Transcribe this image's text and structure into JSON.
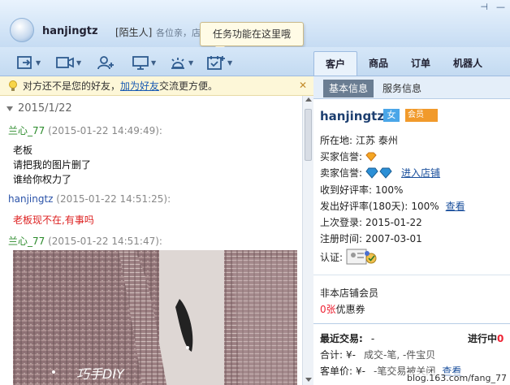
{
  "header": {
    "username": "hanjingtz",
    "tag": "[陌生人]",
    "greeting": "各位亲，店主不"
  },
  "tooltip": {
    "text": "任务功能在这里哦"
  },
  "right_tabs": [
    "客户",
    "商品",
    "订单",
    "机器人"
  ],
  "notice": {
    "before": "对方还不是您的好友，",
    "link": "加为好友",
    "after": "交流更方便。",
    "close": "✕"
  },
  "chat": {
    "date": "2015/1/22",
    "messages": [
      {
        "sender": "兰心_77",
        "time": "(2015-01-22 14:49:49):",
        "lines": [
          "老板",
          "请把我的图片删了",
          "谁给你权力了"
        ]
      },
      {
        "sender": "hanjingtz",
        "time": "(2015-01-22 14:51:25):",
        "lines": [
          "老板现不在,有事吗"
        ]
      },
      {
        "sender": "兰心_77",
        "time": "(2015-01-22 14:51:47):",
        "lines": []
      }
    ],
    "photo_caption": "巧手DIY"
  },
  "profile": {
    "subtabs": [
      "基本信息",
      "服务信息"
    ],
    "name": "hanjingtz",
    "gender_badge": "女",
    "member_badge": "会员",
    "location_label": "所在地:",
    "location_value": "江苏 泰州",
    "buyer_label": "买家信誉:",
    "seller_label": "卖家信誉:",
    "store_link": "进入店铺",
    "good_rate_label": "收到好评率:",
    "good_rate_value": "100%",
    "sent_rate_label": "发出好评率(180天):",
    "sent_rate_value": "100%",
    "view_link": "查看",
    "last_login_label": "上次登录:",
    "last_login_value": "2015-01-22",
    "register_label": "注册时间:",
    "register_value": "2007-03-01",
    "auth_label": "认证:",
    "non_member": "非本店铺会员",
    "coupon_count": "0张",
    "coupon_label": "优惠券",
    "recent_label": "最近交易:",
    "recent_value": "-",
    "in_progress": "进行中",
    "in_progress_count": "0",
    "total_label": "合计:",
    "total_value": "¥-",
    "total_detail": "成交-笔, -件宝贝",
    "unit_label": "客单价:",
    "unit_value": "¥-",
    "unit_detail": "-笔交易被关闭",
    "unit_link": "查看"
  },
  "watermark": "blog.163.com/fang_77"
}
